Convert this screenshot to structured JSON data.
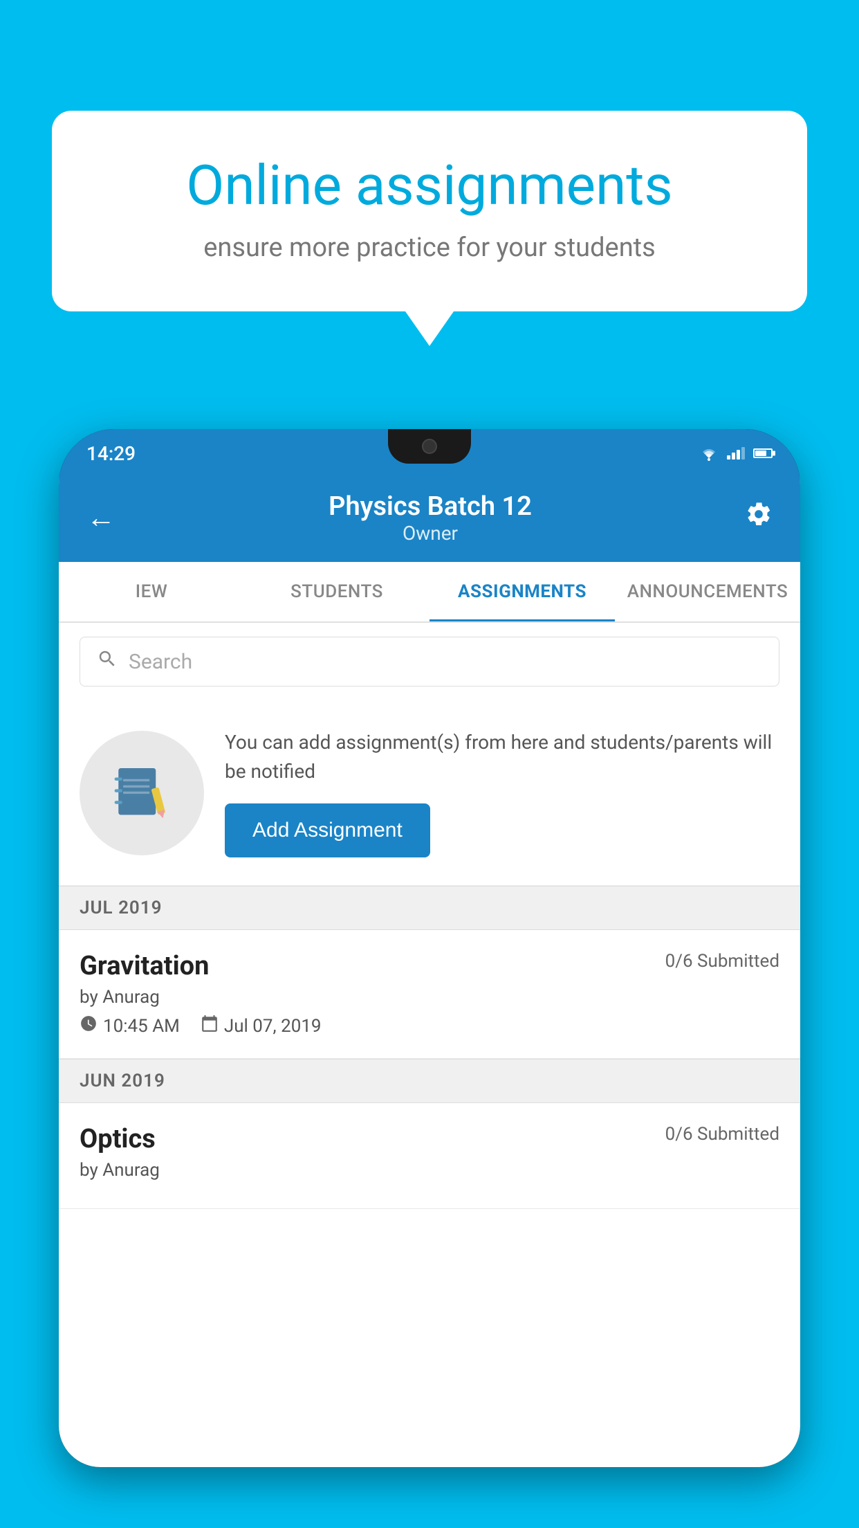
{
  "background_color": "#00BDEF",
  "speech_bubble": {
    "title": "Online assignments",
    "subtitle": "ensure more practice for your students"
  },
  "status_bar": {
    "time": "14:29"
  },
  "app_header": {
    "title": "Physics Batch 12",
    "subtitle": "Owner",
    "back_label": "←",
    "settings_label": "⚙"
  },
  "tabs": [
    {
      "label": "IEW",
      "active": false
    },
    {
      "label": "STUDENTS",
      "active": false
    },
    {
      "label": "ASSIGNMENTS",
      "active": true
    },
    {
      "label": "ANNOUNCEMENTS",
      "active": false
    }
  ],
  "search": {
    "placeholder": "Search"
  },
  "assignment_promo": {
    "description": "You can add assignment(s) from here and students/parents will be notified",
    "button_label": "Add Assignment"
  },
  "sections": [
    {
      "month": "JUL 2019",
      "assignments": [
        {
          "title": "Gravitation",
          "submitted": "0/6 Submitted",
          "by": "by Anurag",
          "time": "10:45 AM",
          "date": "Jul 07, 2019"
        }
      ]
    },
    {
      "month": "JUN 2019",
      "assignments": [
        {
          "title": "Optics",
          "submitted": "0/6 Submitted",
          "by": "by Anurag",
          "time": "",
          "date": ""
        }
      ]
    }
  ]
}
